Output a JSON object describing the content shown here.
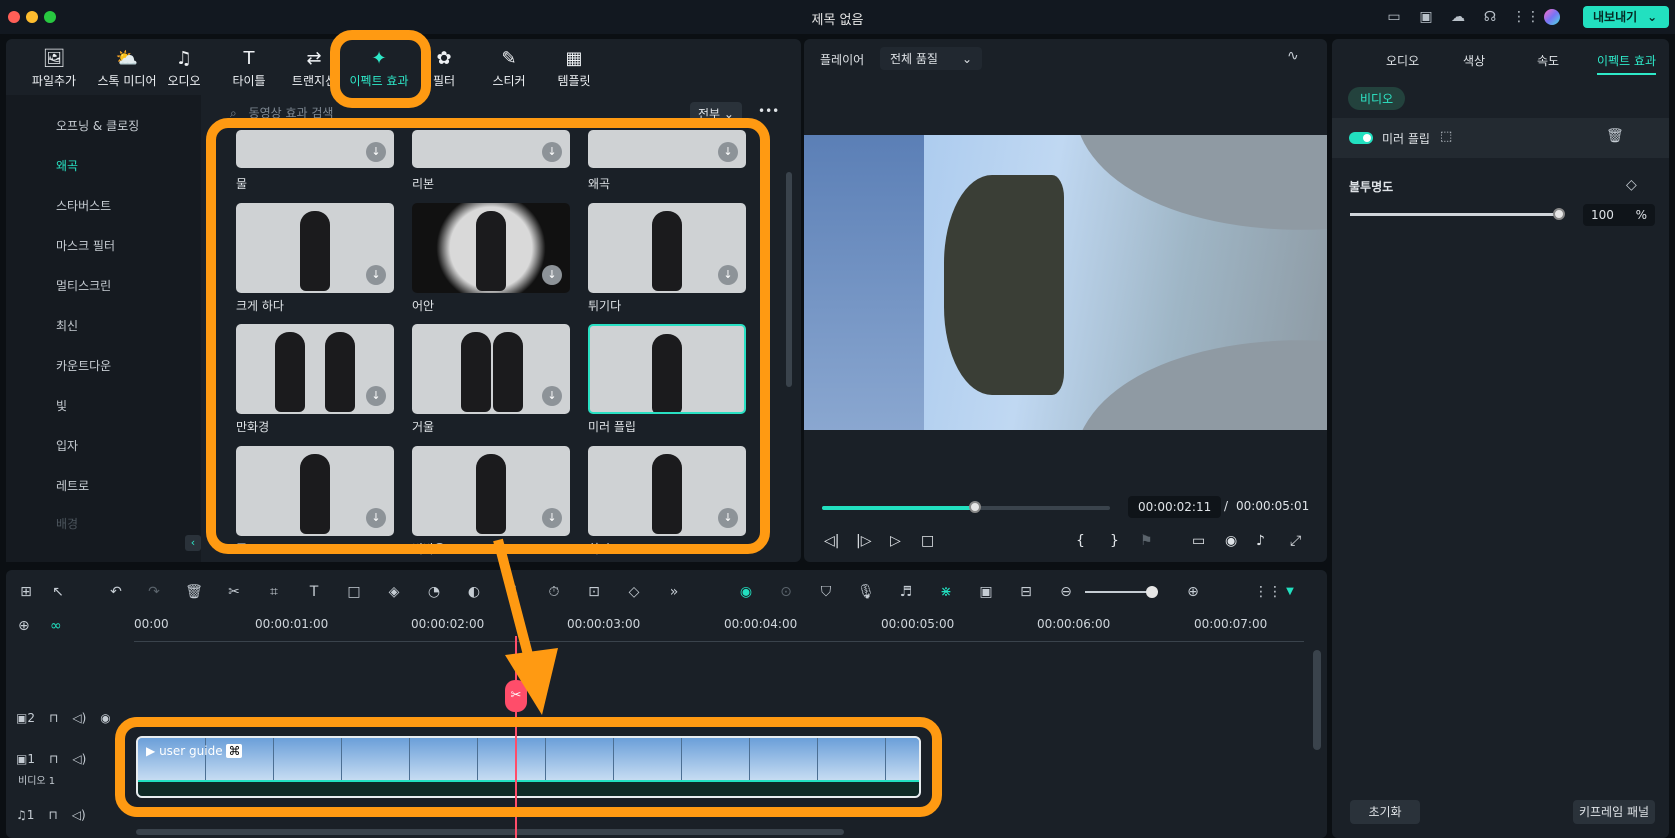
{
  "window": {
    "title": "제목 없음",
    "export_label": "내보내기"
  },
  "media": {
    "tabs": [
      {
        "label": "파일추가",
        "icon": "folder-image-icon"
      },
      {
        "label": "스톡 미디어",
        "icon": "cloud-media-icon"
      },
      {
        "label": "오디오",
        "icon": "music-note-icon"
      },
      {
        "label": "타이틀",
        "icon": "text-t-icon"
      },
      {
        "label": "트랜지션",
        "icon": "transition-icon"
      },
      {
        "label": "이펙트 효과",
        "icon": "sparkle-icon"
      },
      {
        "label": "필터",
        "icon": "filter-icon"
      },
      {
        "label": "스티커",
        "icon": "sticker-icon"
      },
      {
        "label": "템플릿",
        "icon": "template-icon"
      }
    ],
    "sidebar": [
      "오프닝 & 클로징",
      "왜곡",
      "스타버스트",
      "마스크 필터",
      "멀티스크린",
      "최신",
      "카운트다운",
      "빛",
      "입자",
      "레트로",
      "배경"
    ],
    "search_placeholder": "동영상 효과 검색",
    "filter_label": "전부",
    "effects": [
      "물",
      "리본",
      "왜곡",
      "크게 하다",
      "어안",
      "튀기다",
      "만화경",
      "거울",
      "미러 플립",
      "줌",
      "비바움",
      "회전"
    ]
  },
  "player": {
    "label": "플레이어",
    "quality": "전체 품질",
    "current_time": "00:00:02:11",
    "total_time": "00:00:05:01",
    "progress": 0.53
  },
  "props": {
    "tabs": [
      "오디오",
      "색상",
      "속도",
      "이펙트 효과"
    ],
    "section": "비디오",
    "effect_name": "미러 플립",
    "opacity_label": "불투명도",
    "opacity_value": "100",
    "opacity_unit": "%",
    "reset_label": "초기화",
    "keyframe_label": "키프레임 패널"
  },
  "timeline": {
    "timecodes": [
      "00:00",
      "00:00:01:00",
      "00:00:02:00",
      "00:00:03:00",
      "00:00:04:00",
      "00:00:05:00",
      "00:00:06:00",
      "00:00:07:00"
    ],
    "tracks": [
      {
        "num": "2"
      },
      {
        "num": "1",
        "name": "비디오 1"
      },
      {
        "num": "1"
      }
    ],
    "clip_name": "user guide"
  },
  "colors": {
    "accent": "#22e0c0",
    "annotation": "#ff9a12",
    "playhead": "#ff4d6a"
  }
}
